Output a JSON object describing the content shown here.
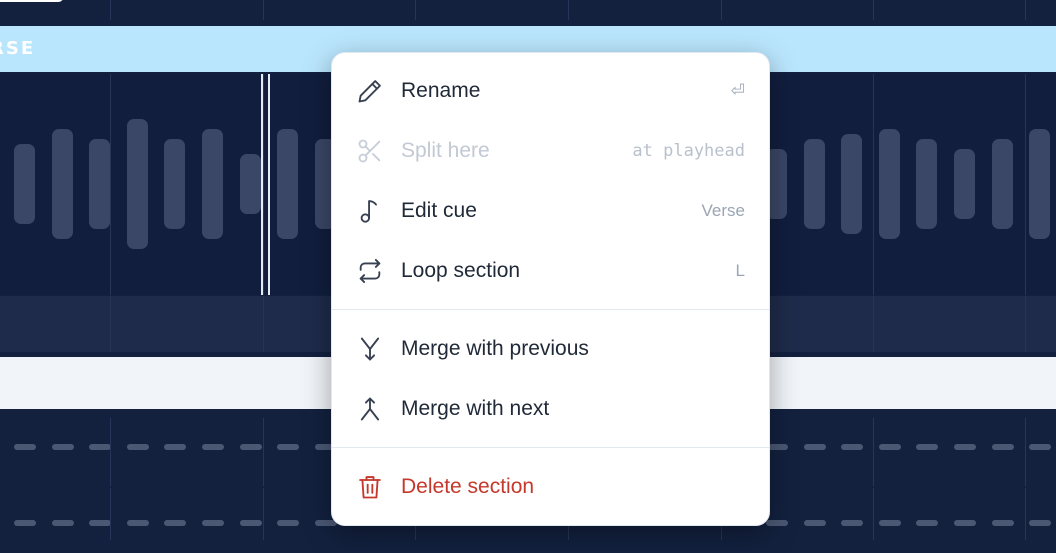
{
  "timeline": {
    "section_label": "RSE"
  },
  "menu": {
    "items": [
      {
        "label": "Rename",
        "shortcut": "⏎",
        "icon": "pencil-icon",
        "disabled": false
      },
      {
        "label": "Split here",
        "shortcut": "at playhead",
        "icon": "scissors-icon",
        "disabled": true
      },
      {
        "label": "Edit cue",
        "shortcut": "Verse",
        "icon": "music-note-icon",
        "disabled": false
      },
      {
        "label": "Loop section",
        "shortcut": "L",
        "icon": "loop-icon",
        "disabled": false
      },
      {
        "label": "Merge with previous",
        "shortcut": "",
        "icon": "merge-previous-icon",
        "disabled": false
      },
      {
        "label": "Merge with next",
        "shortcut": "",
        "icon": "merge-next-icon",
        "disabled": false
      },
      {
        "label": "Delete section",
        "shortcut": "",
        "icon": "trash-icon",
        "disabled": false
      }
    ]
  },
  "colors": {
    "background": "#13213f",
    "section_band": "#bae6fd",
    "danger": "#c6382b",
    "menu_bg": "#ffffff"
  }
}
